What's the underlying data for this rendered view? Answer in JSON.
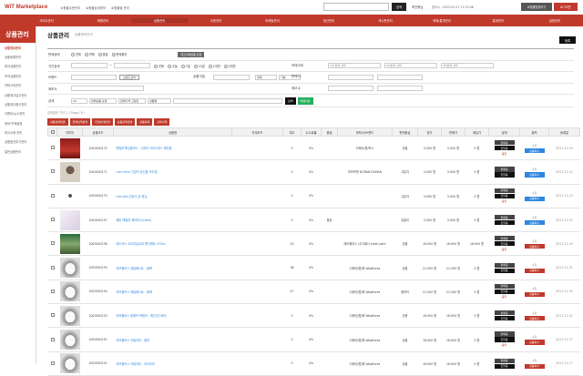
{
  "brand": {
    "logo": "WiT Marketplace"
  },
  "toplinks": [
    "쇼핑몰주문관리",
    "쇼핑몰상세정보",
    "쇼핑몰별 관리"
  ],
  "top": {
    "search_btn": "검색",
    "user": "최진충님",
    "info": "접속시 : 2022-03-27 11:23:48",
    "btn1": "쇼핑몰방문하기",
    "btn2": "로그아웃"
  },
  "nav": [
    "사이트관리",
    "회원관리",
    "상품관리",
    "주문관리",
    "마케팅관리",
    "정산관리",
    "게시판관리",
    "매체/통계관리",
    "통계관리",
    "설정관리"
  ],
  "side": {
    "title": "상품관리",
    "items": [
      "상품정보관리",
      "상품등록관리",
      "재고상품관리",
      "조직상품관리",
      "카테고리관리",
      "상품재고입고관리",
      "상품재고출고관리",
      "이벤트/뉴스관리",
      "정보/구매설정",
      "재고수량 관리",
      "상품옵션추가관리",
      "일반상품관리"
    ]
  },
  "page": {
    "title": "상품관리",
    "breadcrumb": "상품정보관리",
    "reg_btn": "등록"
  },
  "filter": {
    "row1": {
      "label": "판매상태",
      "opts": [
        "전체",
        "판매",
        "품절",
        "판매중지"
      ],
      "extra": "재고삭제상품 포함"
    },
    "row2": {
      "label": "기간검색",
      "opts": [
        "전체",
        "오늘",
        "7일",
        "15일",
        "1개월",
        "3개월"
      ]
    },
    "row3": {
      "label": "브랜드",
      "btn": "브랜드검색",
      "cat": "카테고리",
      "cat_sel": "1차 분류 선택",
      "cat2": "2차분류 선택",
      "cat3": "3차분류 선택"
    },
    "row4": {
      "label": "제조사",
      "label2": "상품구분",
      "sel1": "전체",
      "sel2": "기본",
      "label3": "판매가",
      "label4": "재고수"
    },
    "row5": {
      "label": "검색",
      "sel1": "10",
      "sel2": "판매상품 순정",
      "sel3": "판매가격 고정값",
      "sel4": "상품명",
      "search": "검색",
      "excel": "엑셀다운"
    }
  },
  "bulk_buttons": [
    "상품상태변경",
    "판매상태변경",
    "진열상태변경",
    "상품상태변경",
    "상품복제",
    "선택삭제"
  ],
  "count_text": "검색결과 75건 ( 1 Page / 8 )",
  "table": {
    "headers": [
      "",
      "이미지",
      "상품코드",
      "상품명",
      "자재코드",
      "재고",
      "수수료율",
      "품질",
      "위탁사/브랜드",
      "판매등급",
      "정가",
      "판매가",
      "매입가",
      "상태",
      "출력",
      "등록일"
    ],
    "rows": [
      {
        "img": "red",
        "code": "1000000172",
        "name": "웰컴투게더클라쓰 - 시월의 크리스마스 헤어컬",
        "stock": "0",
        "fee": "0%",
        "qual": "",
        "brand": "더쎄이/원/박스",
        "grade": "공통",
        "price": "5,500 원",
        "sale": "5,500 원",
        "buy": "0 원",
        "date": "2017-10-19"
      },
      {
        "img": "drawn",
        "code": "1000000171",
        "name": "mer+feur 간장이 당신을 모두겠",
        "stock": "0",
        "fee": "0%",
        "qual": "",
        "brand": "모모프랜 DORAN DORAN",
        "grade": "고분자",
        "price": "5,000 원",
        "sale": "5,000 원",
        "buy": "0 원",
        "date": "2017-12-12"
      },
      {
        "img": "small",
        "code": "1000000170",
        "name": "mer-bell-간장이 굳 윈닝",
        "stock": "0",
        "fee": "0%",
        "qual": "",
        "brand": "",
        "grade": "고분자",
        "price": "5,000 원",
        "sale": "5,000 원",
        "buy": "0 원",
        "date": "2017-12-13"
      },
      {
        "img": "light",
        "code": "1000000157",
        "name": "패턴 메탈론 헤어피스(color)",
        "stock": "0",
        "fee": "0%",
        "qual": "품질",
        "brand": "",
        "grade": "쥬얼리",
        "price": "5,500 원",
        "sale": "5,500 원",
        "buy": "0 원",
        "date": "2017-12-07"
      },
      {
        "img": "green",
        "code": "1000000156",
        "name": "메스커스 오리지널슈퍼 펜디예라 470ml",
        "stock": "20",
        "fee": "0%",
        "qual": "",
        "brand": "메모플러스 /주식회사 earth path",
        "grade": "공통",
        "price": "16,000 원",
        "sale": "16,900 원",
        "buy": "16,900 원",
        "date": "2017-11-29"
      },
      {
        "img": "dog",
        "code": "1000000155",
        "name": "와프플러스 제일메니트 - 블랙",
        "stock": "38",
        "fee": "0%",
        "qual": "",
        "brand": "더쎄이/원/파 Wooflures",
        "grade": "공통",
        "price": "21,500 원",
        "sale": "21,500 원",
        "buy": "0 원",
        "date": "2017-11-21"
      },
      {
        "img": "dog",
        "code": "1000000154",
        "name": "와프플러스 제일메니트 - 블랙",
        "stock": "47",
        "fee": "0%",
        "qual": "",
        "brand": "더쎄이/원/파 Wooflures",
        "grade": "중부터",
        "price": "21,500 원",
        "sale": "21,500 원",
        "buy": "0 원",
        "date": "2017-11-20"
      },
      {
        "img": "dog",
        "code": "1000000153",
        "name": "와프플러스 잡화커 복합아 - 레인지그레이",
        "stock": "0",
        "fee": "0%",
        "qual": "",
        "brand": "더쎄이/원/파 Wooflures",
        "grade": "공용",
        "price": "16,900 원",
        "sale": "16,900 원",
        "buy": "0 원",
        "date": "2017-11-21"
      },
      {
        "img": "dog",
        "code": "1000000152",
        "name": "와프플러스 아필자리 - 블루",
        "stock": "0",
        "fee": "0%",
        "qual": "",
        "brand": "더쎄이/원/파 Wooflures",
        "grade": "공통",
        "price": "16,900 원",
        "sale": "16,900 원",
        "buy": "0 원",
        "date": "2017-11-17"
      },
      {
        "img": "dog",
        "code": "1000000151",
        "name": "와프플러스 아필자리 - 아이보리",
        "stock": "0",
        "fee": "0%",
        "qual": "",
        "brand": "더쎄이/원/파 Wooflures",
        "grade": "공통",
        "price": "16,900 원",
        "sale": "16,900 원",
        "buy": "0 원",
        "date": "2017-11-17"
      }
    ]
  },
  "status_labels": {
    "on": "판매중",
    "disp": "진열중",
    "off": "품절"
  },
  "out_labels": {
    "edit": "수정",
    "copy": "상품복사"
  },
  "colors": {
    "accent": "#c0392b",
    "dark": "#111111",
    "green": "#27ae60"
  }
}
